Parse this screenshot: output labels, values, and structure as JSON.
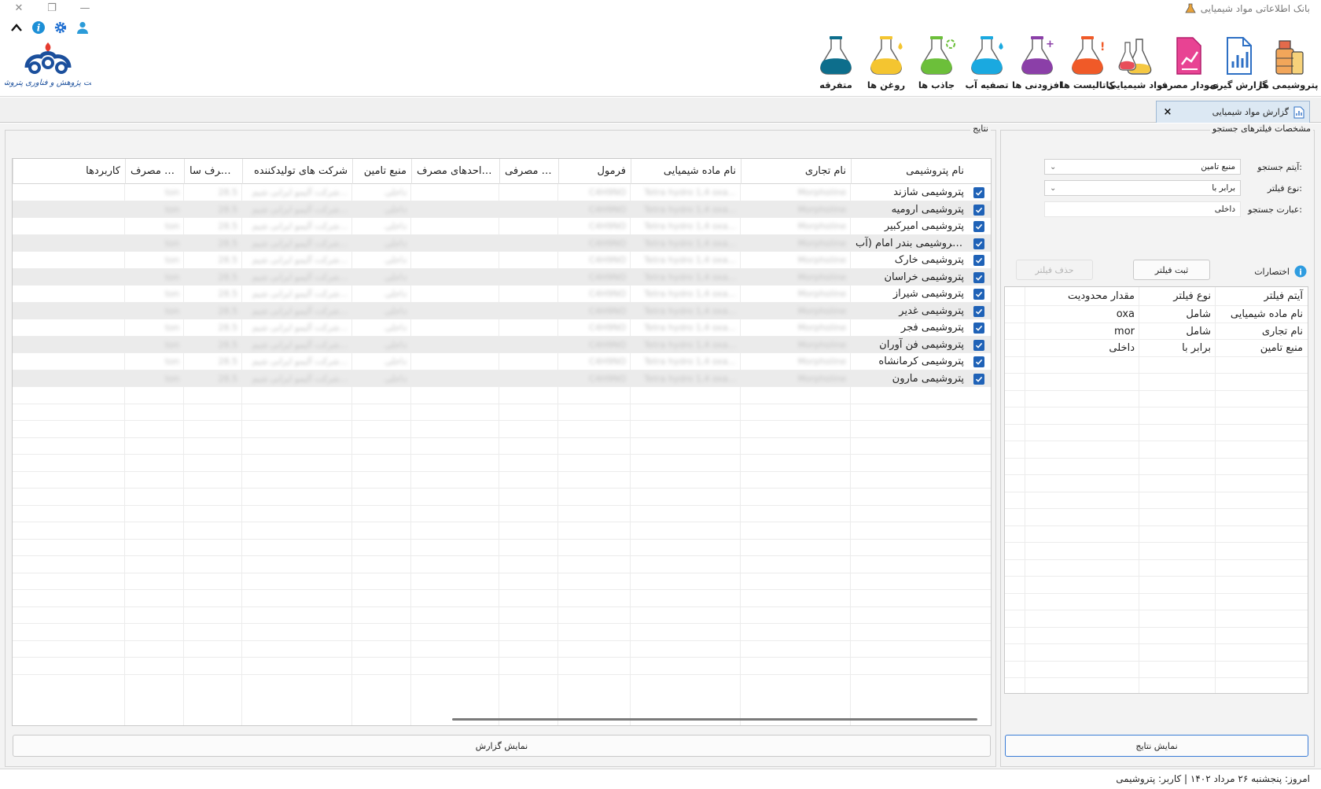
{
  "app": {
    "title": "بانک اطلاعاتی مواد شیمیایی"
  },
  "ribbon": [
    {
      "label": "پتروشیمی ها",
      "icon": "petrochemical-tank-icon"
    },
    {
      "label": "گزارش گیری",
      "icon": "report-document-icon"
    },
    {
      "label": "نمودار مصرف",
      "icon": "consumption-chart-icon"
    },
    {
      "label": "مواد شیمیایی",
      "icon": "chemical-flasks-icon"
    },
    {
      "label": "کاتالیست ها",
      "icon": "catalyst-flask-icon"
    },
    {
      "label": "افزودنی ها",
      "icon": "additive-flask-icon"
    },
    {
      "label": "تصفیه آب",
      "icon": "water-treatment-flask-icon"
    },
    {
      "label": "جاذب ها",
      "icon": "adsorbent-flask-icon"
    },
    {
      "label": "روغن ها",
      "icon": "oil-flask-icon"
    },
    {
      "label": "متفرقه",
      "icon": "misc-flask-icon"
    }
  ],
  "logo": {
    "text": "شرکت پژوهش و فناوری پتروشیمی"
  },
  "tab": {
    "label": "گزارش مواد شیمیایی",
    "close": "×"
  },
  "filters": {
    "title": "مشخصات فیلترهای جستجو",
    "search_item_label": "آیتم جستجو:",
    "search_item_value": "منبع تامین",
    "filter_type_label": "نوع فیلتر:",
    "filter_type_value": "برابر با",
    "search_phrase_label": "عبارت جستجو:",
    "search_phrase_value": "داخلی",
    "shortcuts_label": "اختصارات",
    "register_button": "ثبت فیلتر",
    "delete_button": "حذف فیلتر",
    "table_headers": [
      "آیتم فیلتر",
      "نوع فیلتر",
      "مقدار محدودیت"
    ],
    "table_rows": [
      [
        "نام ماده شیمیایی",
        "شامل",
        "oxa"
      ],
      [
        "نام تجاری",
        "شامل",
        "mor"
      ],
      [
        "منبع تامین",
        "برابر با",
        "داخلی"
      ]
    ],
    "show_results_button": "نمایش نتایج"
  },
  "results": {
    "title": "نتایج",
    "headers": [
      "نام پتروشیمی",
      "نام تجاری",
      "نام ماده شیمیایی",
      "فرمول",
      "گرید مصرفی",
      "واحدهای مصرف ...",
      "منبع تامین",
      "شرکت های تولیدکننده",
      "مصرف سا...",
      "واحد مصرف",
      "کاربردها"
    ],
    "rows": [
      {
        "name": "پتروشیمی شازند",
        "checked": true
      },
      {
        "name": "پتروشیمی ارومیه",
        "checked": true
      },
      {
        "name": "پتروشیمی امیرکبیر",
        "checked": true
      },
      {
        "name": "پتروشیمی بندر امام (آب ...",
        "checked": true
      },
      {
        "name": "پتروشیمی خارک",
        "checked": true
      },
      {
        "name": "پتروشیمی خراسان",
        "checked": true
      },
      {
        "name": "پتروشیمی شیراز",
        "checked": true
      },
      {
        "name": "پتروشیمی غدیر",
        "checked": true
      },
      {
        "name": "پتروشیمی فجر",
        "checked": true
      },
      {
        "name": "پتروشیمی فن آوران",
        "checked": true
      },
      {
        "name": "پتروشیمی کرمانشاه",
        "checked": true
      },
      {
        "name": "پتروشیمی مارون",
        "checked": true
      }
    ],
    "blurred_cells": [
      "Morpholine",
      "Tetra hydro 1,4 oxa...",
      "C4H9NO",
      "",
      "",
      "داخلی",
      "شرکت آلیمو ایرانی شیم...",
      "28.5",
      "ton",
      ""
    ],
    "report_button": "نمایش گزارش"
  },
  "status": {
    "text": "امروز: پنجشنبه ۲۶ مرداد ۱۴۰۲  |  کاربر: پتروشیمی"
  }
}
